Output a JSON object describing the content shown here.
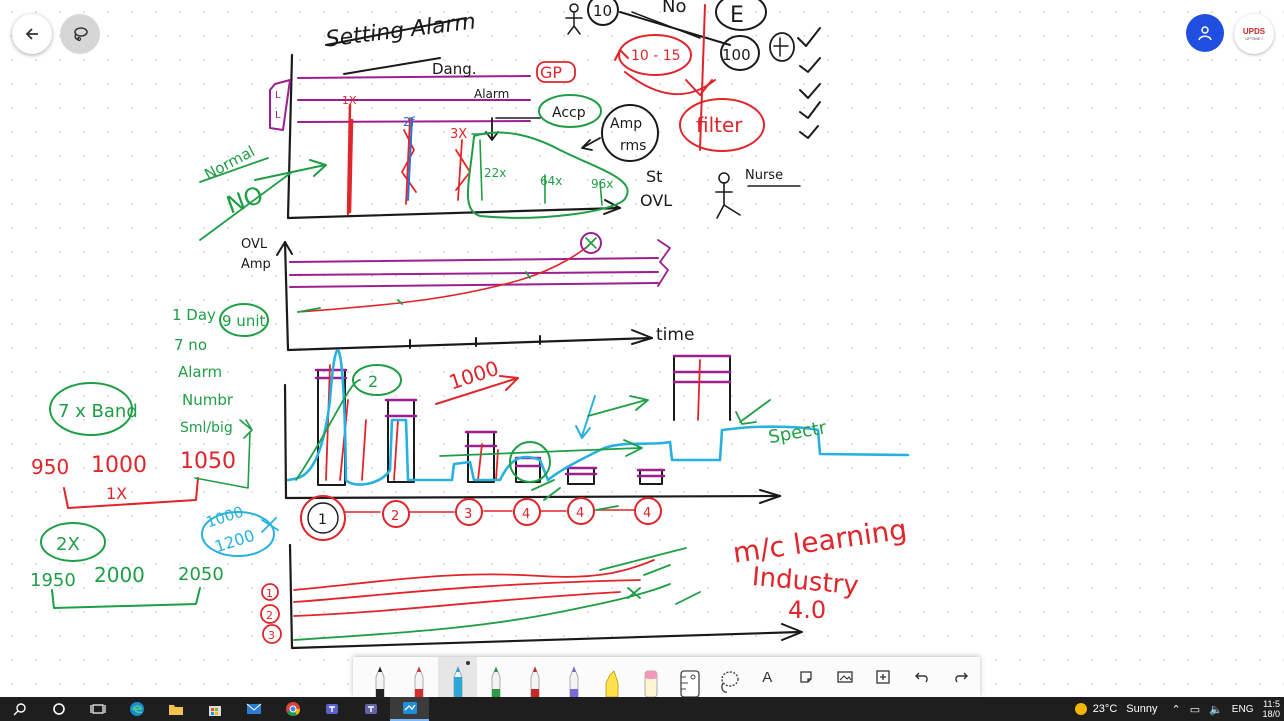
{
  "app": {
    "name": "Microsoft Whiteboard"
  },
  "top_left": {
    "back_icon": "arrow-left-icon",
    "lasso_icon": "lasso-icon"
  },
  "top_right": {
    "user_icon": "person-icon",
    "org_logo_text": "UPDS",
    "org_logo_subtext": "UPTIME I"
  },
  "whiteboard": {
    "title": "Setting Alarm",
    "labels": {
      "no": "No",
      "e": "E",
      "ten": "10",
      "ten_fifteen": "10 - 15",
      "hundred": "100",
      "filter": "filter",
      "nurse": "Nurse",
      "dang": "Dang.",
      "gp": "GP",
      "alarm": "Alarm",
      "accp": "Accp",
      "amp": "Amp",
      "rms": "rms",
      "normal": "Normal",
      "no_big": "NO",
      "one_x": "1X",
      "two_f": "2f",
      "three_x": "3X",
      "harm_22x": "22x",
      "harm_64x": "64x",
      "harm_96x": "96x",
      "st": "St",
      "ovl": "OVL",
      "ovl_axis": "OVL",
      "amp_axis": "Amp",
      "time": "time",
      "one_day": "1 Day",
      "nine_unit": "9 unit",
      "seven_no": "7 no",
      "alarm2": "Alarm",
      "number": "Numbr",
      "sml_big": "Sml/big",
      "seven_x_band": "7 x Band",
      "n950": "950",
      "n1000": "1000",
      "n1050": "1050",
      "one_x_bottom": "1X",
      "two_x": "2X",
      "n1950": "1950",
      "n2000": "2000",
      "n2050": "2050",
      "n1000_blue": "1000",
      "n1200_blue": "1200",
      "n1000_red": "1000",
      "two_circ": "2",
      "spectrum": "Spectr",
      "mc_learning": "m/c learning",
      "industry": "Industry",
      "four_zero": "4.0",
      "band_1": "1",
      "band_2": "2",
      "band_3": "3",
      "band_4": "4",
      "band_4b": "4",
      "band_4c": "4",
      "row_1": "1",
      "row_2": "2",
      "row_3": "3"
    },
    "ink_colors": {
      "black": "#1a1a1a",
      "red": "#e0252b",
      "green": "#1e9e45",
      "purple": "#9b1f8f",
      "blue": "#2a6fd6",
      "cyan": "#27b1e0"
    }
  },
  "pen_toolbar": {
    "tools": [
      {
        "name": "black-pen",
        "icon": "pen-icon",
        "color": "#222222"
      },
      {
        "name": "red-pen",
        "icon": "pen-icon",
        "color": "#d32f2f"
      },
      {
        "name": "cyan-pen",
        "icon": "pen-icon",
        "color": "#2aa8d8",
        "selected": true
      },
      {
        "name": "green-pen",
        "icon": "pen-icon",
        "color": "#2e9a44"
      },
      {
        "name": "dark-red-pen",
        "icon": "pen-icon",
        "color": "#c62828"
      },
      {
        "name": "multicolor-pen",
        "icon": "pen-icon",
        "color": "#7a6ad8"
      },
      {
        "name": "yellow-highlighter",
        "icon": "highlighter-icon",
        "color": "#ffd60a"
      },
      {
        "name": "eraser",
        "icon": "eraser-icon",
        "color": "#ef9ab8"
      },
      {
        "name": "ruler",
        "icon": "ruler-icon",
        "color": "#444444"
      },
      {
        "name": "lasso-select",
        "icon": "lasso-icon",
        "color": "#444444"
      }
    ],
    "actions": [
      {
        "name": "add-text",
        "icon": "text-icon",
        "label": "A"
      },
      {
        "name": "add-note",
        "icon": "sticky-note-icon"
      },
      {
        "name": "add-image",
        "icon": "image-icon"
      },
      {
        "name": "insert",
        "icon": "plus-box-icon"
      },
      {
        "name": "undo",
        "icon": "undo-icon"
      },
      {
        "name": "redo",
        "icon": "redo-icon"
      }
    ]
  },
  "taskbar": {
    "apps": [
      "search-icon",
      "task-view-icon",
      "multitasking-icon",
      "edge-icon",
      "file-explorer-icon",
      "store-icon",
      "mail-icon",
      "chrome-icon",
      "teams-icon",
      "teams-icon-2",
      "whiteboard-icon"
    ],
    "weather": {
      "temp": "23°C",
      "condition": "Sunny"
    },
    "language": "ENG",
    "clock_time": "11:5",
    "clock_date": "18/0"
  }
}
